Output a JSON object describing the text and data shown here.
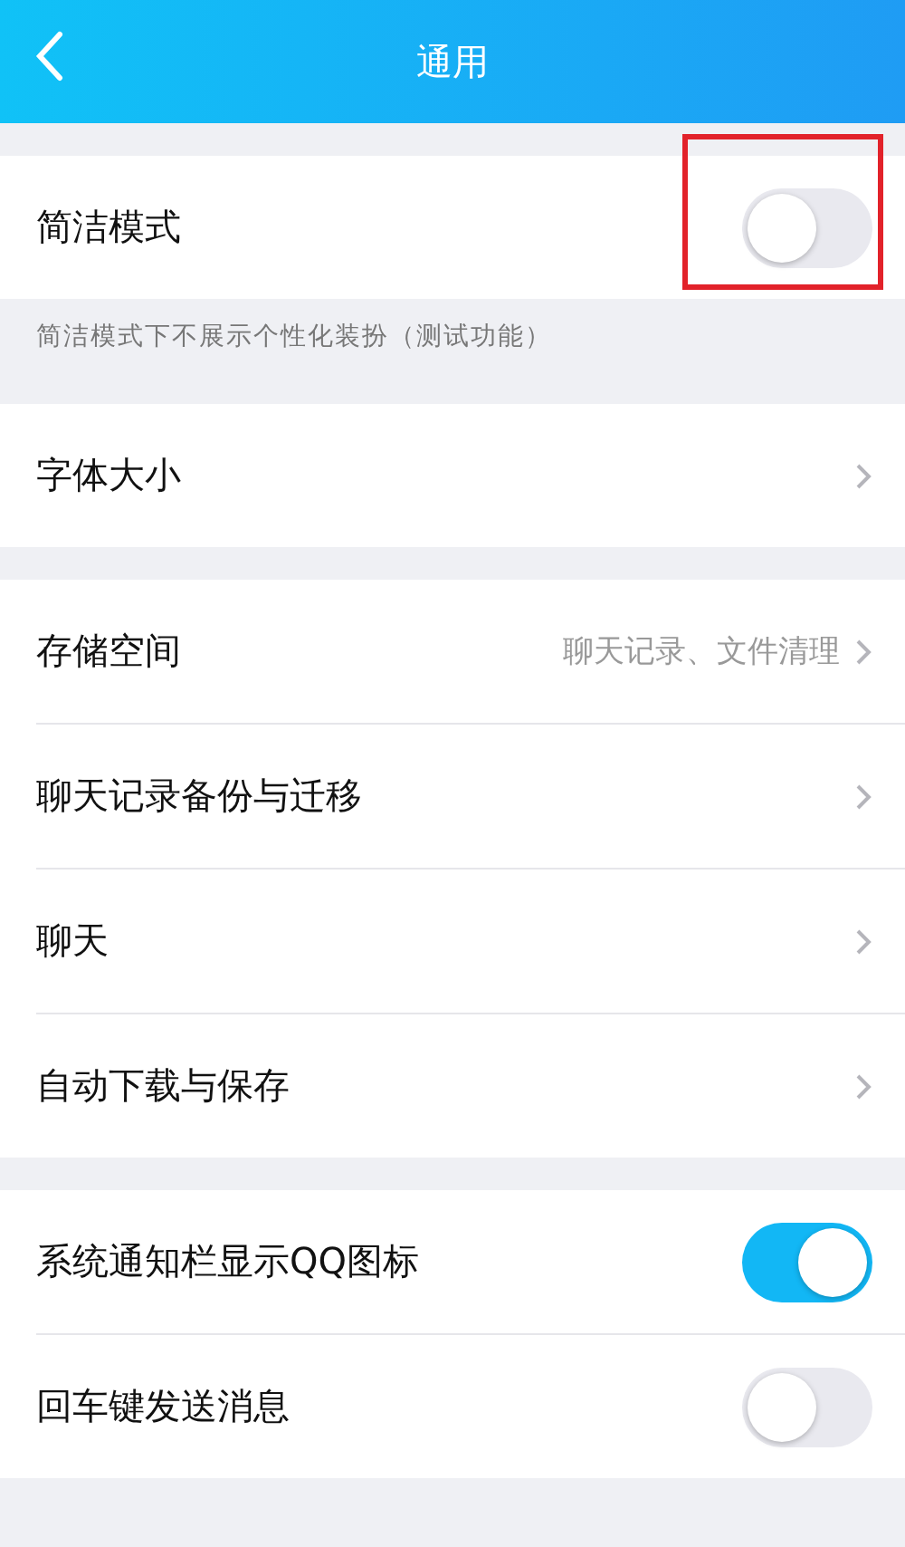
{
  "header": {
    "title": "通用"
  },
  "groups": [
    {
      "rows": [
        {
          "kind": "toggle",
          "label": "简洁模式",
          "on": false,
          "highlighted": true
        }
      ],
      "note": "简洁模式下不展示个性化装扮（测试功能）"
    },
    {
      "rows": [
        {
          "kind": "link",
          "label": "字体大小"
        }
      ]
    },
    {
      "rows": [
        {
          "kind": "link",
          "label": "存储空间",
          "value": "聊天记录、文件清理"
        },
        {
          "kind": "link",
          "label": "聊天记录备份与迁移"
        },
        {
          "kind": "link",
          "label": "聊天"
        },
        {
          "kind": "link",
          "label": "自动下载与保存"
        }
      ]
    },
    {
      "rows": [
        {
          "kind": "toggle",
          "label": "系统通知栏显示QQ图标",
          "on": true,
          "highlighted": false
        },
        {
          "kind": "toggle",
          "label": "回车键发送消息",
          "on": false,
          "highlighted": false
        }
      ]
    }
  ]
}
